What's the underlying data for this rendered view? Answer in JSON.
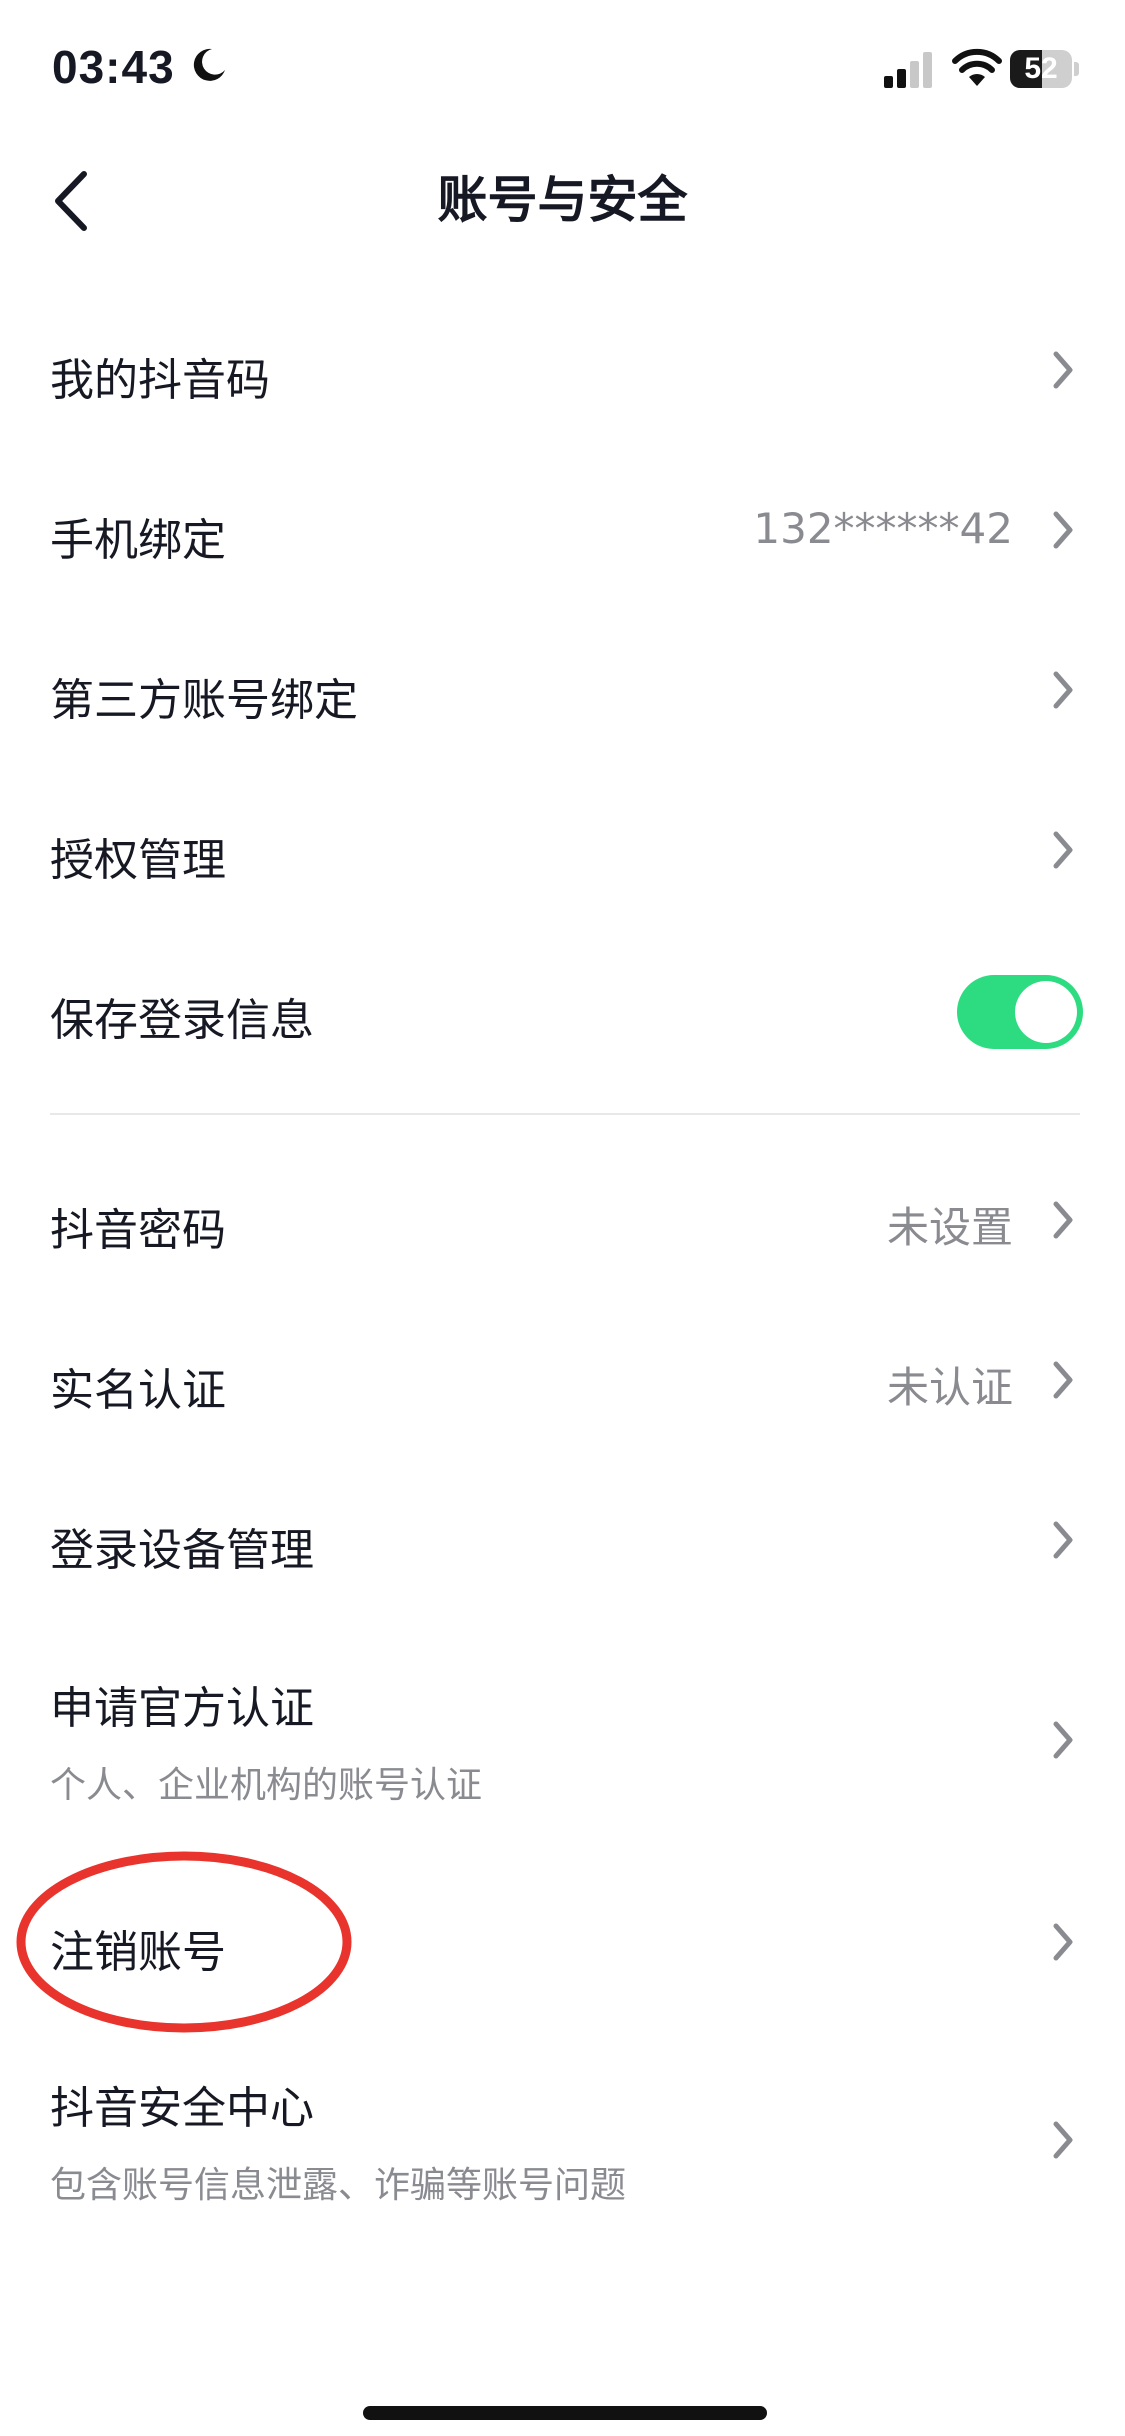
{
  "status_bar": {
    "time": "03:43",
    "battery": "52",
    "battery_level": 0.52
  },
  "header": {
    "title": "账号与安全"
  },
  "rows": [
    {
      "label": "我的抖音码"
    },
    {
      "label": "手机绑定",
      "value": "132******42"
    },
    {
      "label": "第三方账号绑定"
    },
    {
      "label": "授权管理"
    },
    {
      "label": "保存登录信息",
      "toggle_on": true
    },
    {
      "label": "抖音密码",
      "value": "未设置"
    },
    {
      "label": "实名认证",
      "value": "未认证"
    },
    {
      "label": "登录设备管理"
    },
    {
      "label": "申请官方认证",
      "subtitle": "个人、企业机构的账号认证"
    },
    {
      "label": "注销账号",
      "highlighted": true
    },
    {
      "label": "抖音安全中心",
      "subtitle": "包含账号信息泄露、诈骗等账号问题"
    }
  ],
  "colors": {
    "toggle_on": "#2ddc81",
    "annotation_circle": "#e8342c",
    "secondary_text": "#8a8b91"
  }
}
